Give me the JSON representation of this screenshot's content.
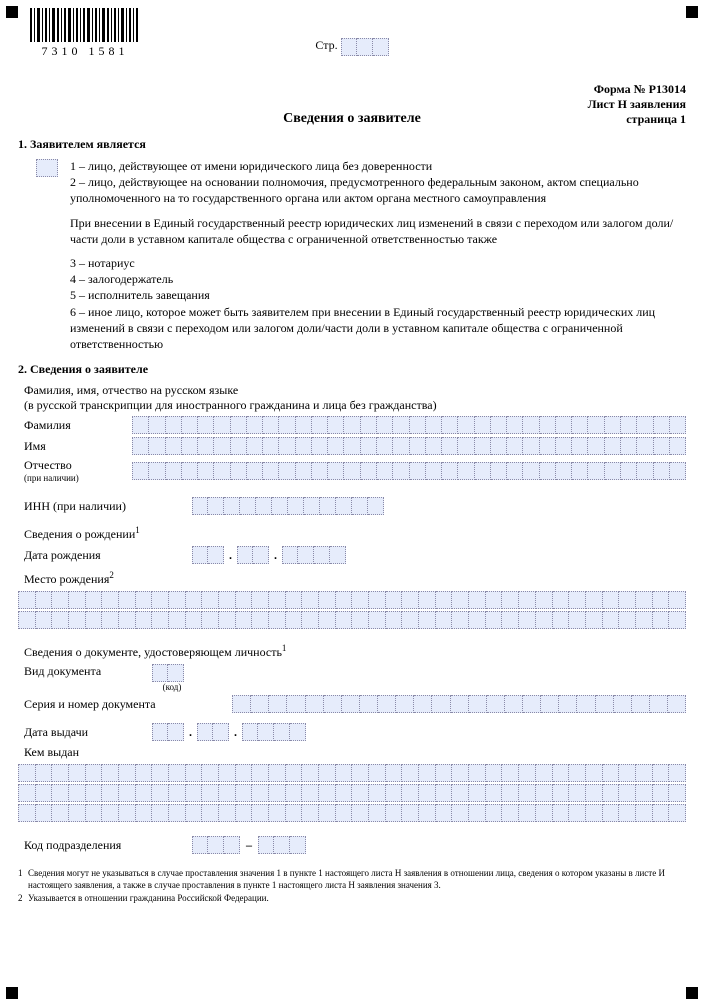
{
  "barcode_number": "7310 1581",
  "page_label": "Стр.",
  "form_id_line1": "Форма № Р13014",
  "form_id_line2": "Лист Н заявления",
  "form_id_line3": "страница 1",
  "doc_title": "Сведения о заявителе",
  "section1": {
    "heading": "1. Заявителем является",
    "opt1": "1 – лицо, действующее от имени юридического лица без доверенности",
    "opt2": "2 – лицо, действующее на основании полномочия, предусмотренного федеральным законом, актом специально уполномоченного на то государственного органа или актом органа местного самоуправления",
    "note": "При внесении в Единый государственный реестр юридических лиц изменений в связи с переходом или залогом доли/части доли в уставном капитале общества с ограниченной ответственностью также",
    "opt3": "3 – нотариус",
    "opt4": "4 – залогодержатель",
    "opt5": "5 – исполнитель завещания",
    "opt6": "6 – иное лицо, которое может быть заявителем при внесении в Единый государственный реестр юридических лиц изменений в связи с переходом или залогом доли/части доли в уставном капитале общества с ограниченной ответственностью"
  },
  "section2": {
    "heading": "2. Сведения о заявителе",
    "fio_note1": "Фамилия, имя, отчество на русском языке",
    "fio_note2": "(в русской транскрипции для иностранного гражданина и лица без гражданства)",
    "surname_label": "Фамилия",
    "name_label": "Имя",
    "patronymic_label": "Отчество",
    "patronymic_sub": "(при наличии)",
    "inn_label": "ИНН (при наличии)",
    "birth_heading": "Сведения о рождении",
    "birth_date_label": "Дата рождения",
    "birth_place_label": "Место рождения",
    "iddoc_heading": "Сведения о документе, удостоверяющем личность",
    "doc_type_label": "Вид документа",
    "doc_type_sub": "(код)",
    "doc_sn_label": "Серия и номер документа",
    "issue_date_label": "Дата выдачи",
    "issued_by_label": "Кем выдан",
    "dept_code_label": "Код подразделения"
  },
  "footnotes": {
    "f1": "Сведения могут не указываться в случае проставления значения 1 в пункте 1 настоящего листа Н заявления в отношении лица, сведения о котором указаны в листе И настоящего заявления, а также в случае проставления в пункте 1 настоящего листа Н заявления значения 3.",
    "f2": "Указывается в отношении гражданина Российской Федерации."
  }
}
